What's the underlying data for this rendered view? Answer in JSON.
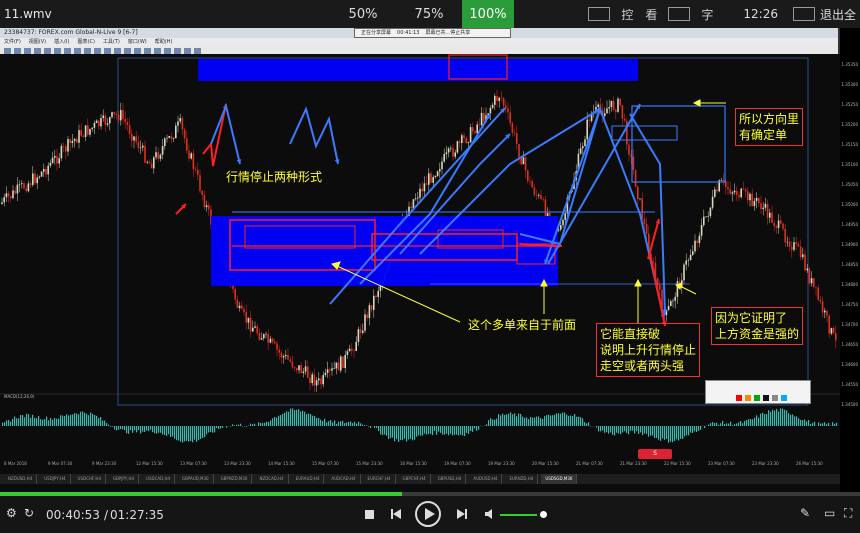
{
  "player": {
    "filename": "11.wmv",
    "zoom_options": [
      "50%",
      "75%",
      "100%"
    ],
    "top_labels": [
      "控",
      "看",
      "字"
    ],
    "clock": "12:26",
    "exit_label": "退出全",
    "elapsed": "00:40:53",
    "duration": "01:27:35",
    "progress": 0.467,
    "volume": 0.85
  },
  "platform": {
    "title": "23384737: FOREX.com Global-N-Live 9 [6-7]",
    "menu": [
      "文件(F)",
      "视图(V)",
      "插入(I)",
      "图表(C)",
      "工具(T)",
      "窗口(W)",
      "帮助(H)"
    ],
    "float_bar": [
      "正在分享屏幕",
      "00:41:13",
      "屏幕已共...停止共享"
    ],
    "chart_symbol": "USDSGD,M30",
    "indicator_label": "MACD(12,26,9)",
    "price_ticks": [
      "1.35350",
      "1.35300",
      "1.35250",
      "1.35200",
      "1.35150",
      "1.35100",
      "1.35050",
      "1.35000",
      "1.34950",
      "1.34900",
      "1.34850",
      "1.34800",
      "1.34750",
      "1.34700",
      "1.34650",
      "1.34600",
      "1.34550",
      "1.34500"
    ],
    "date_ticks": [
      "8 Mar 2018",
      "9 Mar 07:30",
      "9 Mar 23:30",
      "12 Mar 15:30",
      "13 Mar 07:30",
      "13 Mar 23:30",
      "14 Mar 15:30",
      "15 Mar 07:30",
      "15 Mar 23:30",
      "16 Mar 15:30",
      "19 Mar 07:30",
      "19 Mar 23:30",
      "20 Mar 15:30",
      "21 Mar 07:30",
      "21 Mar 23:30",
      "22 Mar 15:30",
      "23 Mar 07:30",
      "23 Mar 23:30",
      "26 Mar 15:30"
    ],
    "symbol_tabs": [
      "NZDUSD,H4",
      "USDJPY,H4",
      "USDCHF,H4",
      "GBPJPY,H4",
      "USDCAD,H4",
      "GBPAUD,M30",
      "GBPNZD,M30",
      "NZDCAD,H4",
      "EURAUD,H4",
      "AUDCAD,H4",
      "EURCHF,H4",
      "GBPCHF,H4",
      "GBPUSD,H4",
      "AUDUSD,H4",
      "EURNZD,H4",
      "USDSGD,M30"
    ],
    "selected_tab": "USDSGD,M30",
    "palette": [
      "#ff0000",
      "#ff8800",
      "#00aa00",
      "#111111",
      "#888888",
      "#00aaff"
    ]
  },
  "annotations": {
    "stop_forms": "行情停止两种形式",
    "direction": [
      "所以方向里",
      "有确定单"
    ],
    "proof": [
      "因为它证明了",
      "上方资金是强的"
    ],
    "long_from": "这个多单来自于前面",
    "break_text": [
      "它能直接破",
      "说明上升行情停止",
      "走空或者两头强"
    ]
  },
  "colors": {
    "accent_green": "#2a9d3a",
    "annotation_yellow": "#ffff33",
    "zone_blue": "#0000ff",
    "line_red": "#ff2020",
    "line_blue": "#3a7bff",
    "bull_candle": "#d8d8c0",
    "bear_candle": "#e03020",
    "macd_teal": "#3fb8b0"
  }
}
